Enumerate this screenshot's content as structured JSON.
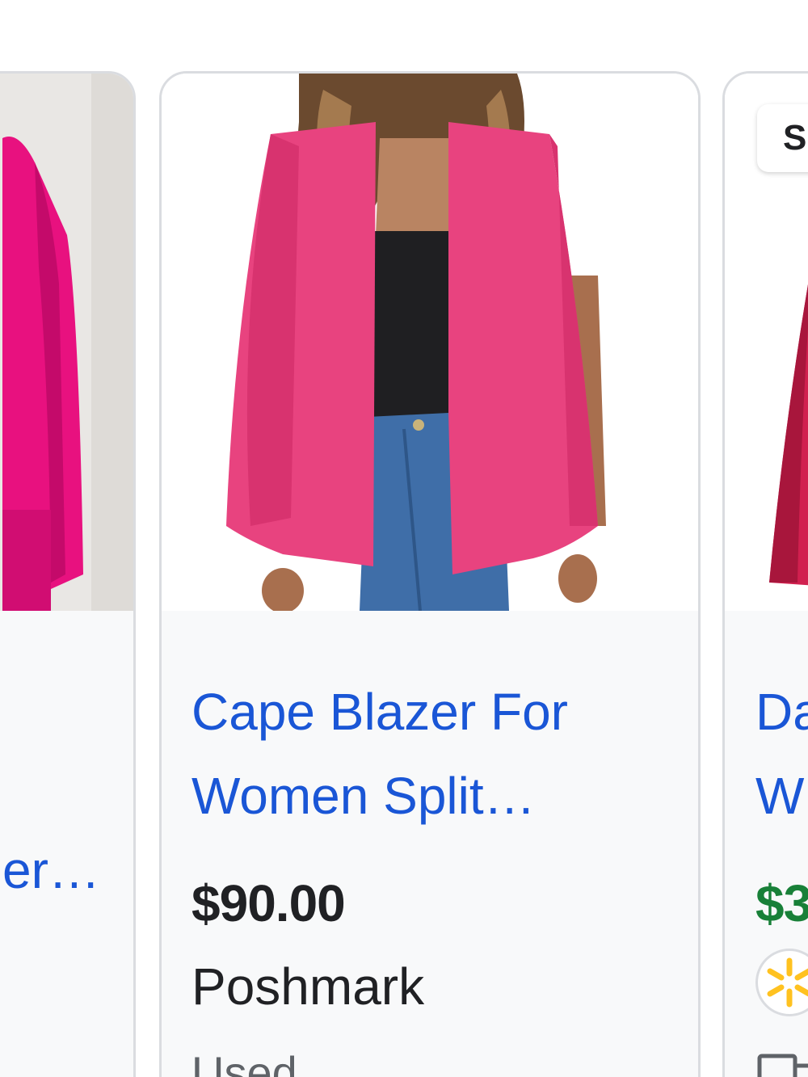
{
  "cards": [
    {
      "id": "left",
      "title_line2": "er…"
    },
    {
      "id": "center",
      "title_line1": "Cape Blazer For",
      "title_line2": "Women Split…",
      "price": "$90.00",
      "seller": "Poshmark",
      "condition": "Used"
    },
    {
      "id": "right",
      "badge": "S",
      "title_line1": "Da",
      "title_line2": "W",
      "price": "$3"
    }
  ],
  "colors": {
    "link": "#1a56d6",
    "price": "#202124",
    "sale_price": "#188038",
    "blazer_pink": "#e8437f",
    "magenta": "#e8117f",
    "card_border": "#dadce0",
    "card_bg": "#f8f9fa"
  },
  "icons": {
    "store_logo": "walmart-spark-icon",
    "delivery": "delivery-truck-icon"
  }
}
